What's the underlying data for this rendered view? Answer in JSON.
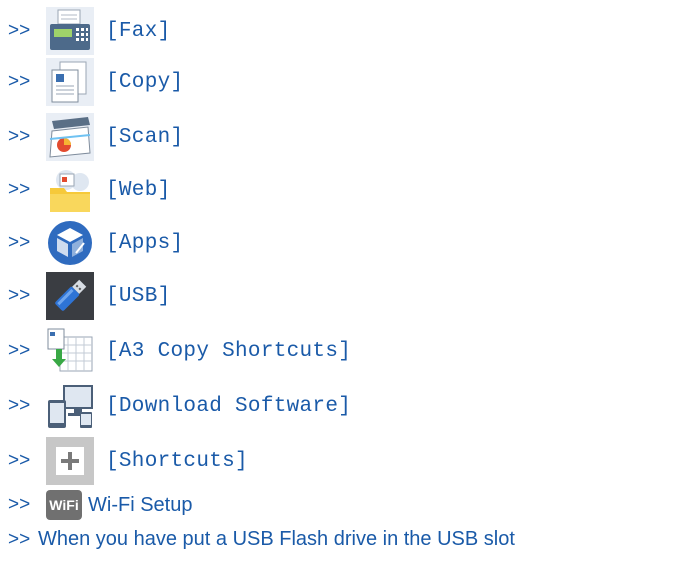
{
  "items": [
    {
      "arrow": ">>",
      "label": "[Fax]"
    },
    {
      "arrow": ">>",
      "label": "[Copy]"
    },
    {
      "arrow": ">>",
      "label": "[Scan]"
    },
    {
      "arrow": ">>",
      "label": "[Web]"
    },
    {
      "arrow": ">>",
      "label": "[Apps]"
    },
    {
      "arrow": ">>",
      "label": "[USB]"
    },
    {
      "arrow": ">>",
      "label": "[A3 Copy Shortcuts]"
    },
    {
      "arrow": ">>",
      "label": "[Download Software]"
    },
    {
      "arrow": ">>",
      "label": "[Shortcuts]"
    }
  ],
  "wifi": {
    "arrow": ">>",
    "badge": "WiFi",
    "label": "Wi-Fi Setup"
  },
  "usb_link": {
    "arrow": ">>",
    "label": "When you have put a USB Flash drive in the USB slot"
  },
  "colors": {
    "link": "#1a5aa8"
  }
}
